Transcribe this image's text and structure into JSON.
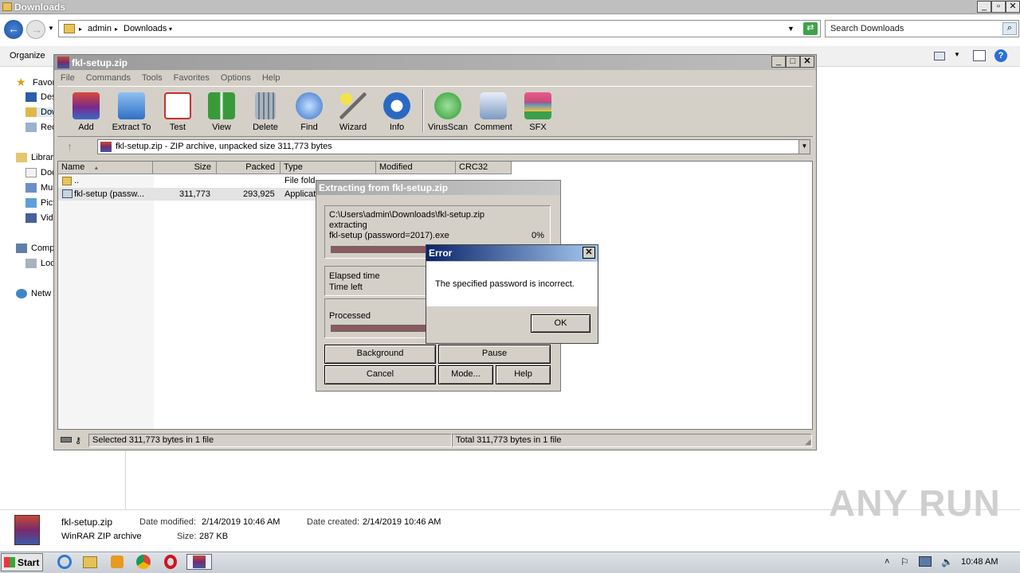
{
  "explorer": {
    "title": "Downloads",
    "breadcrumb": [
      "admin",
      "Downloads"
    ],
    "search_placeholder": "Search Downloads",
    "organize": "Organize",
    "nav": [
      {
        "label": "Favor",
        "icon": "star-icon"
      },
      {
        "label": "Des",
        "icon": "desktop-icon"
      },
      {
        "label": "Dow",
        "icon": "downloads-folder-icon"
      },
      {
        "label": "Rec",
        "icon": "recent-places-icon"
      },
      {
        "label": "Librar",
        "icon": "libraries-icon"
      },
      {
        "label": "Doc",
        "icon": "documents-icon"
      },
      {
        "label": "Mus",
        "icon": "music-icon"
      },
      {
        "label": "Pict",
        "icon": "pictures-icon"
      },
      {
        "label": "Vide",
        "icon": "videos-icon"
      },
      {
        "label": "Comp",
        "icon": "computer-icon"
      },
      {
        "label": "Loc",
        "icon": "local-disk-icon"
      },
      {
        "label": "Netw",
        "icon": "network-icon"
      }
    ],
    "details": {
      "filename": "fkl-setup.zip",
      "type": "WinRAR ZIP archive",
      "modified_label": "Date modified:",
      "modified": "2/14/2019 10:46 AM",
      "created_label": "Date created:",
      "created": "2/14/2019 10:46 AM",
      "size_label": "Size:",
      "size": "287 KB"
    }
  },
  "winrar": {
    "title": "fkl-setup.zip",
    "menu": [
      "File",
      "Commands",
      "Tools",
      "Favorites",
      "Options",
      "Help"
    ],
    "toolbar": [
      {
        "label": "Add",
        "icon": "add-archive-icon",
        "color": "#b33a2a"
      },
      {
        "label": "Extract To",
        "icon": "extract-folder-icon",
        "color": "#3f7fd6"
      },
      {
        "label": "Test",
        "icon": "test-checklist-icon",
        "color": "#c9302c"
      },
      {
        "label": "View",
        "icon": "view-book-icon",
        "color": "#3a9a3a"
      },
      {
        "label": "Delete",
        "icon": "trash-icon",
        "color": "#8d9aa6"
      },
      {
        "label": "Find",
        "icon": "magnifier-icon",
        "color": "#3a6fc9"
      },
      {
        "label": "Wizard",
        "icon": "wand-icon",
        "color": "#6aaa3a"
      },
      {
        "label": "Info",
        "icon": "info-icon",
        "color": "#2b68c4"
      },
      {
        "label": "VirusScan",
        "icon": "virus-scan-icon",
        "color": "#2e9a2e"
      },
      {
        "label": "Comment",
        "icon": "comment-icon",
        "color": "#7d9ac4"
      },
      {
        "label": "SFX",
        "icon": "sfx-box-icon",
        "color": "#c44a7a"
      }
    ],
    "path_text": "fkl-setup.zip - ZIP archive, unpacked size 311,773 bytes",
    "columns": [
      "Name",
      "Size",
      "Packed",
      "Type",
      "Modified",
      "CRC32"
    ],
    "rows": [
      {
        "name": "..",
        "size": "",
        "packed": "",
        "type": "File fold"
      },
      {
        "name": "fkl-setup (passw...",
        "size": "311,773",
        "packed": "293,925",
        "type": "Applicat"
      }
    ],
    "status_left": "Selected 311,773 bytes in 1 file",
    "status_right": "Total 311,773 bytes in 1 file"
  },
  "extract_dialog": {
    "title": "Extracting from fkl-setup.zip",
    "path": "C:\\Users\\admin\\Downloads\\fkl-setup.zip",
    "action": "extracting",
    "file": "fkl-setup (password=2017).exe",
    "percent": "0%",
    "elapsed_label": "Elapsed time",
    "left_label": "Time left",
    "processed_label": "Processed",
    "buttons": {
      "background": "Background",
      "pause": "Pause",
      "cancel": "Cancel",
      "mode": "Mode...",
      "help": "Help"
    }
  },
  "error_dialog": {
    "title": "Error",
    "message": "The specified password is incorrect.",
    "ok": "OK"
  },
  "taskbar": {
    "start": "Start",
    "time": "10:48 AM"
  },
  "watermark": "ANY RUN"
}
